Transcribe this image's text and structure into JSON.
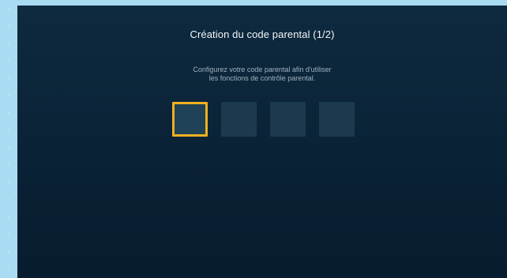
{
  "screen": {
    "title": "Création du code parental (1/2)",
    "instructions": {
      "line1": "Configurez votre code parental afin d'utiliser",
      "line2": "les fonctions de contrôle parental."
    },
    "code_digits": [
      {
        "value": "",
        "active": true
      },
      {
        "value": "",
        "active": false
      },
      {
        "value": "",
        "active": false
      },
      {
        "value": "",
        "active": false
      }
    ]
  },
  "colors": {
    "focus_border": "#f0b021",
    "background": "#0b2438",
    "box": "#1c3a4e"
  }
}
